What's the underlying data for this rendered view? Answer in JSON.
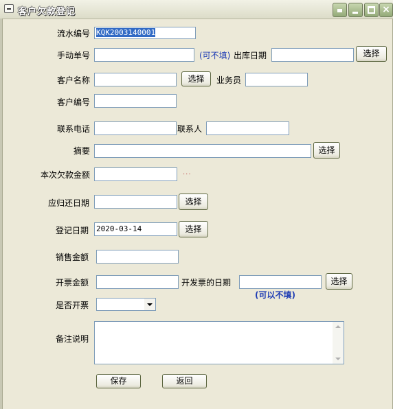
{
  "window": {
    "title": "客户欠款登记"
  },
  "form": {
    "serial_label": "流水编号",
    "serial_value": "KQK2003140001",
    "manual_label": "手动单号",
    "manual_value": "",
    "manual_note": "(可不填)",
    "outdate_label": "出库日期",
    "outdate_value": "",
    "customer_name_label": "客户名称",
    "customer_name_value": "",
    "salesman_label": "业务员",
    "salesman_value": "",
    "customer_code_label": "客户编号",
    "customer_code_value": "",
    "phone_label": "联系电话",
    "phone_value": "",
    "contact_label": "联系人",
    "contact_value": "",
    "summary_label": "摘要",
    "summary_value": "",
    "debt_amount_label": "本次欠款金额",
    "debt_amount_value": "",
    "debt_dots": "...",
    "due_date_label": "应归还日期",
    "due_date_value": "",
    "reg_date_label": "登记日期",
    "reg_date_value": "2020-03-14",
    "sales_amount_label": "销售金额",
    "sales_amount_value": "",
    "invoice_amount_label": "开票金额",
    "invoice_amount_value": "",
    "invoice_date_label": "开发票的日期",
    "invoice_date_value": "",
    "invoice_date_note": "(可以不填)",
    "invoiced_label": "是否开票",
    "invoiced_value": "",
    "remark_label": "备注说明",
    "remark_value": ""
  },
  "buttons": {
    "choose": "选择",
    "save": "保存",
    "back": "返回"
  }
}
